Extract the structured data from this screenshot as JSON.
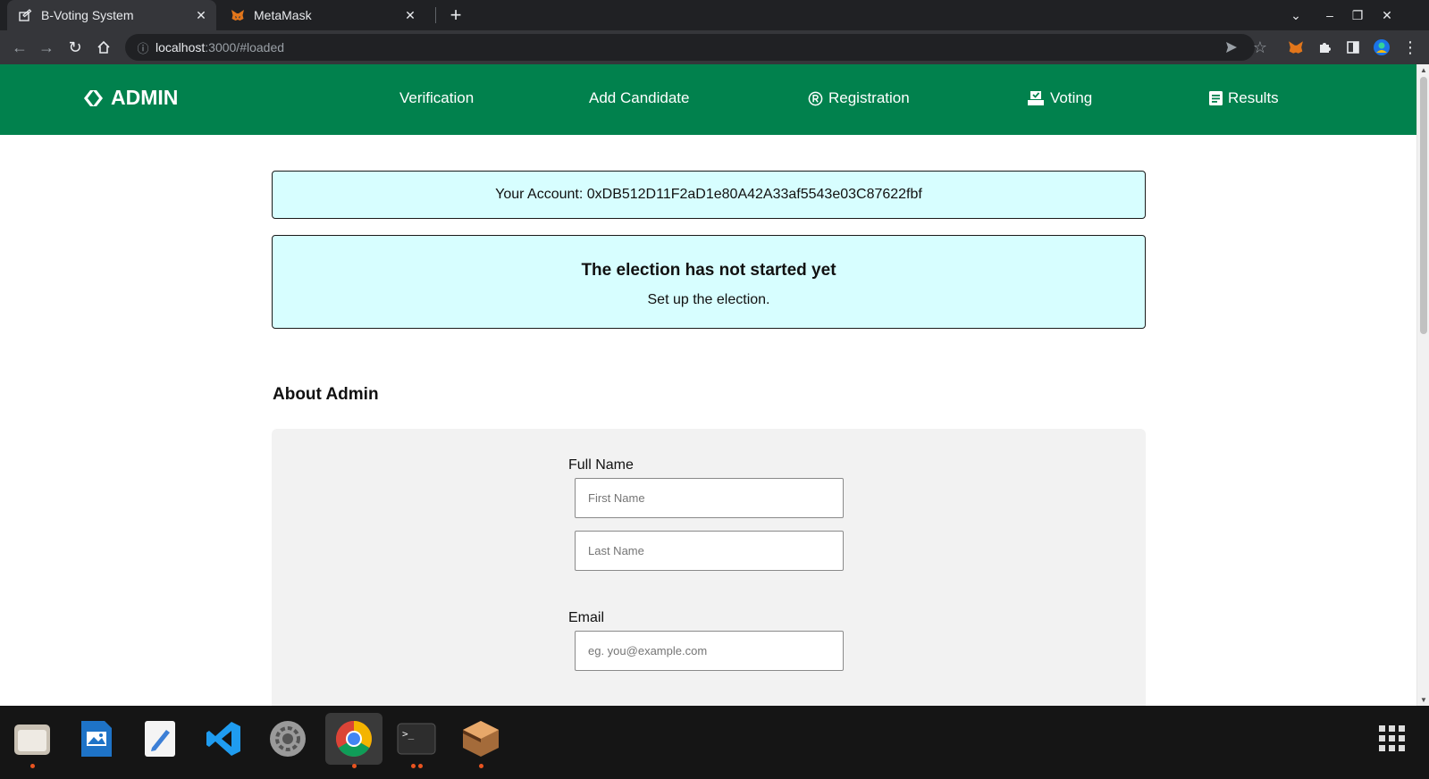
{
  "browser": {
    "tabs": [
      {
        "title": "B-Voting System",
        "active": true,
        "icon": "ballot-icon"
      },
      {
        "title": "MetaMask",
        "active": false,
        "icon": "metamask-fox-icon"
      }
    ],
    "url_host": "localhost",
    "url_rest": ":3000/#loaded"
  },
  "navbar": {
    "brand": "ADMIN",
    "links": [
      {
        "label": "Verification"
      },
      {
        "label": "Add Candidate"
      },
      {
        "label": "Registration",
        "icon": "registered-icon"
      },
      {
        "label": "Voting",
        "icon": "ballot-box-icon"
      },
      {
        "label": "Results",
        "icon": "document-icon"
      }
    ],
    "bg_color": "#01814d"
  },
  "account": {
    "text": "Your Account: 0xDB512D11F2aD1e80A42A33af5543e03C87622fbf"
  },
  "election_status": {
    "heading": "The election has not started yet",
    "message": "Set up the election."
  },
  "about_admin": {
    "title": "About Admin",
    "full_name_label": "Full Name",
    "first_name_placeholder": "First Name",
    "last_name_placeholder": "Last Name",
    "email_label": "Email",
    "email_placeholder": "eg. you@example.com"
  },
  "taskbar": {
    "apps": [
      "files-icon",
      "image-viewer-icon",
      "text-editor-icon",
      "vscode-icon",
      "settings-icon",
      "chrome-icon",
      "terminal-icon",
      "ganache-icon"
    ],
    "active_app": "chrome-icon"
  }
}
